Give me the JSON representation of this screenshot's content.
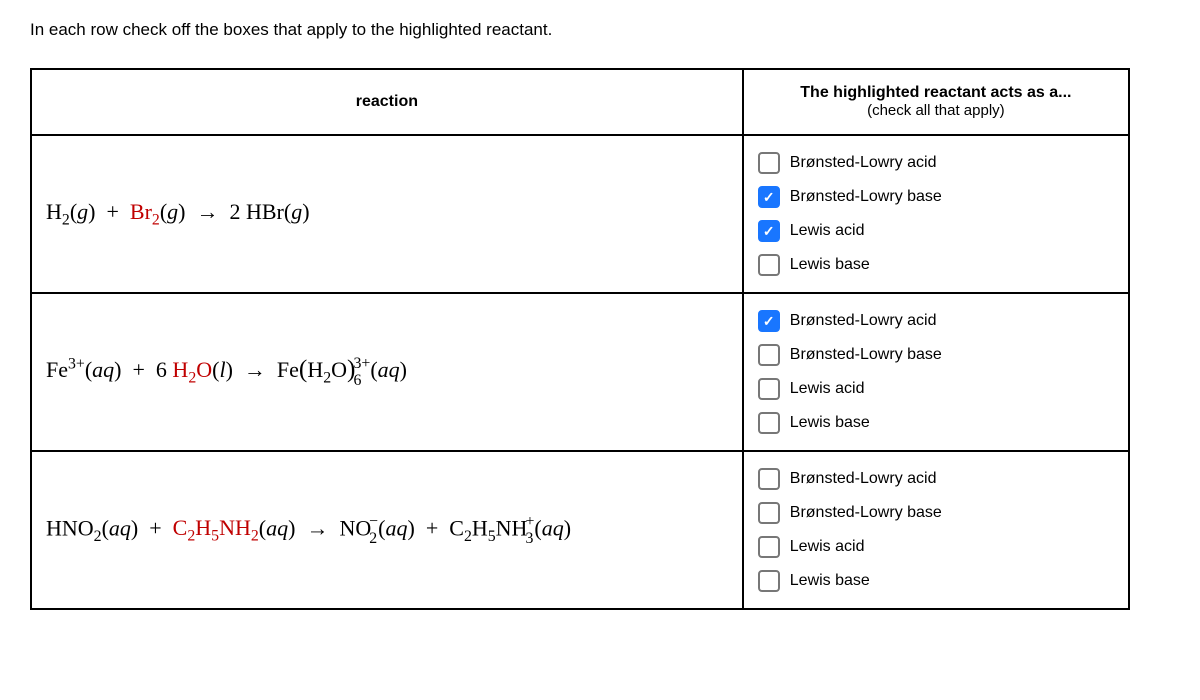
{
  "instruction": "In each row check off the boxes that apply to the highlighted reactant.",
  "headers": {
    "reaction": "reaction",
    "acts_as": "The highlighted reactant acts as a...",
    "acts_as_sub": "(check all that apply)"
  },
  "options": {
    "bl_acid": "Brønsted-Lowry acid",
    "bl_base": "Brønsted-Lowry base",
    "l_acid": "Lewis acid",
    "l_base": "Lewis base"
  },
  "rows": [
    {
      "checks": {
        "bl_acid": false,
        "bl_base": true,
        "l_acid": true,
        "l_base": false
      }
    },
    {
      "checks": {
        "bl_acid": true,
        "bl_base": false,
        "l_acid": false,
        "l_base": false
      }
    },
    {
      "checks": {
        "bl_acid": false,
        "bl_base": false,
        "l_acid": false,
        "l_base": false
      }
    }
  ],
  "chem": {
    "g": "g",
    "l": "l",
    "aq": "aq",
    "arrow": "→",
    "plus": "+",
    "two": "2",
    "three_plus": "3+",
    "six": "6",
    "five": "5",
    "three": "3",
    "H": "H",
    "Br": "Br",
    "HBr": "HBr",
    "Fe": "Fe",
    "H2O": "H",
    "O": "O",
    "HNO": "HNO",
    "NO": "NO",
    "C": "C",
    "NH": "NH"
  }
}
